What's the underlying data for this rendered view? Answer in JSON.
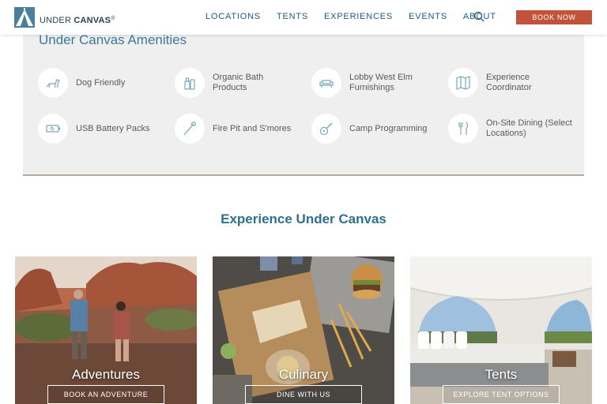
{
  "header": {
    "logo": {
      "part1": "UNDER ",
      "part2": "CANVAS",
      "mark": "®"
    },
    "nav": [
      "LOCATIONS",
      "TENTS",
      "EXPERIENCES",
      "EVENTS",
      "ABOUT"
    ],
    "book_now": "BOOK NOW"
  },
  "amenities": {
    "title": "Under Canvas Amenities",
    "items": [
      {
        "label": "Dog Friendly",
        "icon": "dog-icon"
      },
      {
        "label": "Organic Bath Products",
        "icon": "bath-products-icon"
      },
      {
        "label": "Lobby West Elm Furnishings",
        "icon": "sofa-icon"
      },
      {
        "label": "Experience Coordinator",
        "icon": "map-icon"
      },
      {
        "label": "USB Battery Packs",
        "icon": "battery-icon"
      },
      {
        "label": "Fire Pit and S'mores",
        "icon": "marshmallow-stick-icon"
      },
      {
        "label": "Camp Programming",
        "icon": "guitar-icon"
      },
      {
        "label": "On-Site Dining (Select Locations)",
        "icon": "fork-knife-icon"
      }
    ]
  },
  "experience": {
    "title": "Experience Under Canvas",
    "cards": [
      {
        "title": "Adventures",
        "button": "BOOK AN ADVENTURE"
      },
      {
        "title": "Culinary",
        "button": "DINE WITH US"
      },
      {
        "title": "Tents",
        "button": "EXPLORE TENT OPTIONS"
      }
    ]
  },
  "colors": {
    "accent": "#c2533a",
    "nav_text": "#1f5d7e",
    "title_blue": "#3c7a9a",
    "panel_bg": "#efefef"
  }
}
